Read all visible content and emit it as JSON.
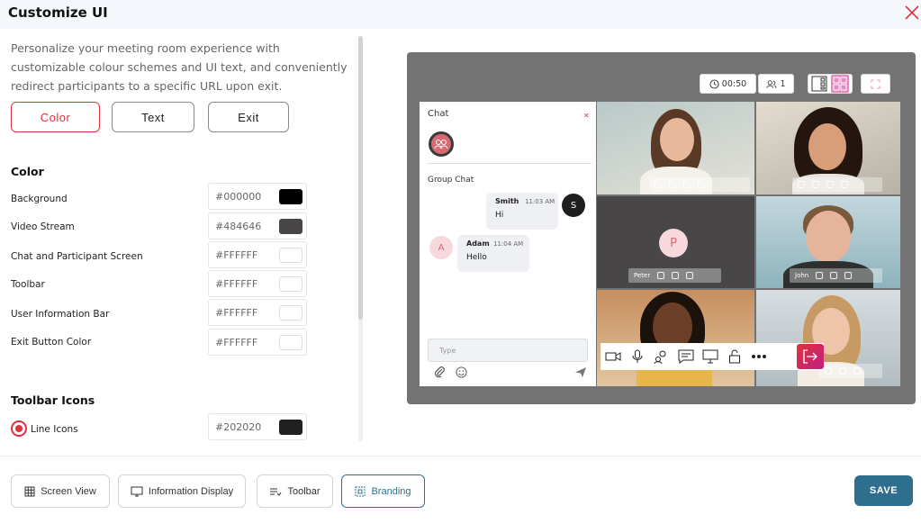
{
  "header": {
    "title": "Customize UI"
  },
  "description": "Personalize your meeting room experience with customizable colour schemes and UI text, and conveniently redirect participants to a specific URL upon exit.",
  "tabs": [
    {
      "label": "Color",
      "active": true
    },
    {
      "label": "Text",
      "active": false
    },
    {
      "label": "Exit",
      "active": false
    }
  ],
  "color_section": {
    "title": "Color",
    "rows": [
      {
        "label": "Background",
        "hex": "#000000",
        "swatch": "#000000"
      },
      {
        "label": "Video Stream",
        "hex": "#484646",
        "swatch": "#484646"
      },
      {
        "label": "Chat and Participant Screen",
        "hex": "#FFFFFF",
        "swatch": "#FFFFFF"
      },
      {
        "label": "Toolbar",
        "hex": "#FFFFFF",
        "swatch": "#FFFFFF"
      },
      {
        "label": "User Information Bar",
        "hex": "#FFFFFF",
        "swatch": "#FFFFFF"
      },
      {
        "label": "Exit Button Color",
        "hex": "#FFFFFF",
        "swatch": "#FFFFFF"
      }
    ]
  },
  "toolbar_icons": {
    "title": "Toolbar Icons",
    "option_label": "Line Icons",
    "hex": "#202020",
    "swatch": "#202020"
  },
  "bottom_nav": [
    {
      "label": "Screen View",
      "icon": "grid-icon",
      "active": false
    },
    {
      "label": "Information Display",
      "icon": "monitor-icon",
      "active": false
    },
    {
      "label": "Toolbar",
      "icon": "toolbar-icon",
      "active": false
    },
    {
      "label": "Branding",
      "icon": "branding-icon",
      "active": true
    }
  ],
  "save_label": "SAVE",
  "preview": {
    "timer": "00:50",
    "participants": "1",
    "chat": {
      "title": "Chat",
      "group_label": "Group Chat",
      "messages": [
        {
          "name": "Smith",
          "time": "11:03 AM",
          "text": "Hi",
          "avatar": "S"
        },
        {
          "name": "Adam",
          "time": "11:04 AM",
          "text": "Hello",
          "avatar": "A"
        }
      ],
      "input_placeholder": "Type"
    },
    "tiles": [
      {
        "name": ""
      },
      {
        "name": ""
      },
      {
        "name": "Peter",
        "avatar": "P"
      },
      {
        "name": "John"
      },
      {
        "name": ""
      },
      {
        "name": ""
      }
    ]
  },
  "colors": {
    "accent": "#e0313c",
    "primary": "#2e6f8e",
    "preview_bg": "#737373"
  }
}
